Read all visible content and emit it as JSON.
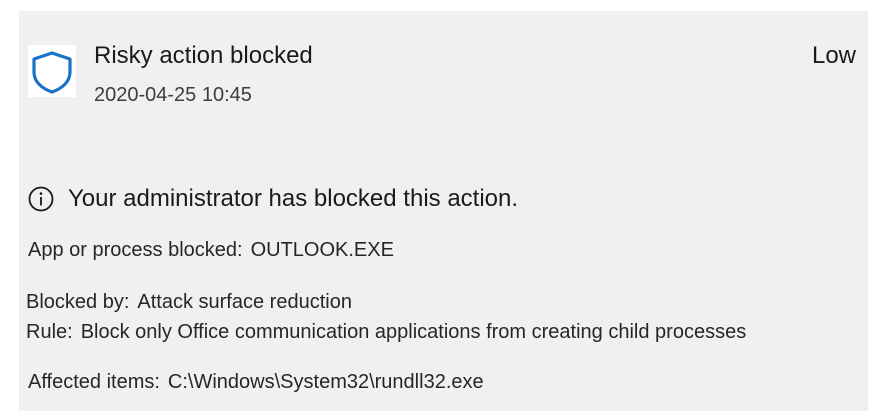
{
  "alert": {
    "title": "Risky action blocked",
    "severity": "Low",
    "timestamp": "2020-04-25 10:45",
    "icon": "shield-icon",
    "accent_color": "#1a73c9"
  },
  "message": {
    "icon": "info-icon",
    "text": "Your administrator has blocked this action."
  },
  "details": {
    "app_label": "App or process blocked:",
    "app_value": "OUTLOOK.EXE",
    "blocked_by_label": "Blocked by:",
    "blocked_by_value": "Attack surface reduction",
    "rule_label": "Rule:",
    "rule_value": "Block only Office communication applications from creating child processes",
    "affected_label": "Affected items:",
    "affected_value": "C:\\Windows\\System32\\rundll32.exe"
  }
}
